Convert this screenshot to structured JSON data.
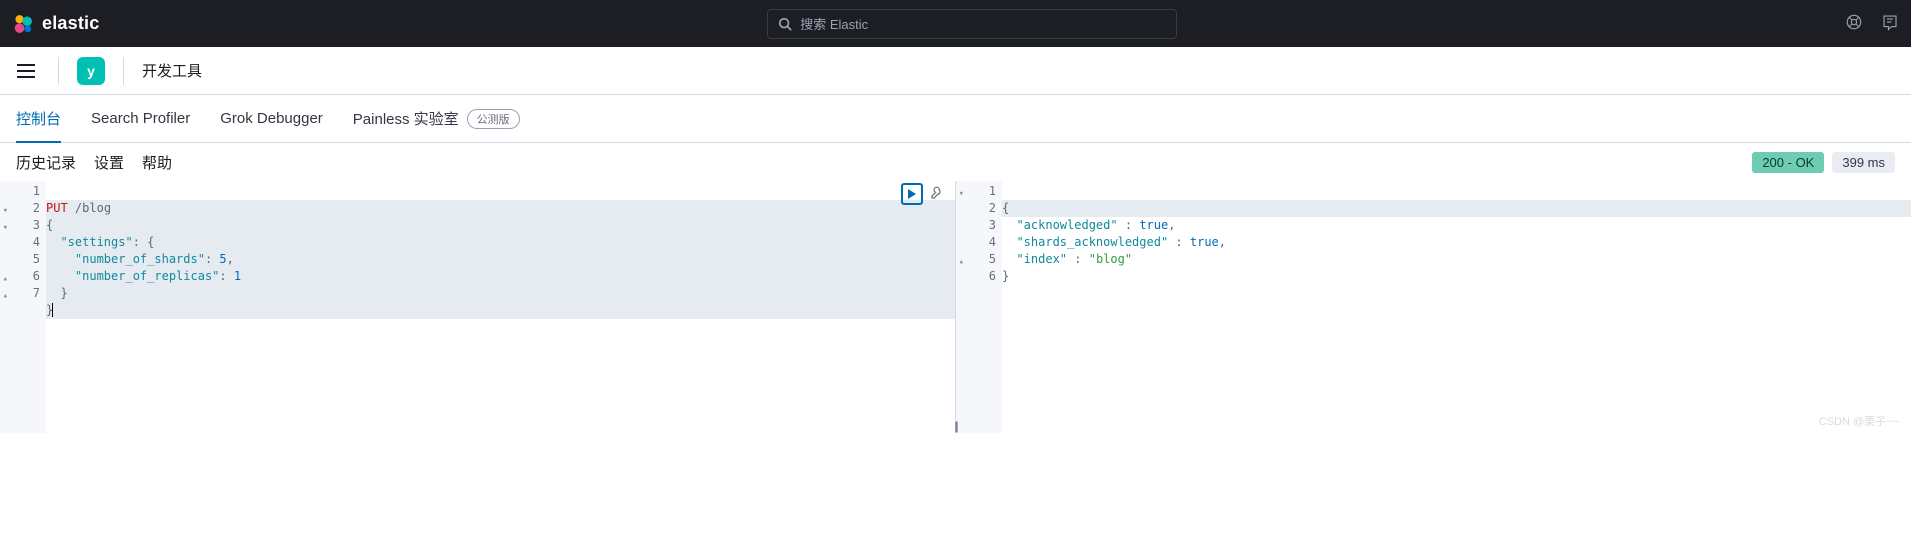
{
  "header": {
    "brand": "elastic",
    "search_placeholder": "搜索 Elastic"
  },
  "subheader": {
    "space_initial": "y",
    "crumb": "开发工具"
  },
  "tabs": [
    {
      "label": "控制台",
      "active": true
    },
    {
      "label": "Search Profiler"
    },
    {
      "label": "Grok Debugger"
    },
    {
      "label": "Painless 实验室",
      "beta": "公测版"
    }
  ],
  "toolbar": {
    "history": "历史记录",
    "settings": "设置",
    "help": "帮助",
    "status": "200 - OK",
    "time": "399 ms"
  },
  "request": {
    "method": "PUT",
    "path": "/blog",
    "lines": [
      {
        "n": "1"
      },
      {
        "n": "2",
        "fold": "▾"
      },
      {
        "n": "3",
        "fold": "▾"
      },
      {
        "n": "4"
      },
      {
        "n": "5"
      },
      {
        "n": "6",
        "fold": "▴"
      },
      {
        "n": "7",
        "fold": "▴"
      }
    ],
    "body": {
      "settings_key": "\"settings\"",
      "shards_key": "\"number_of_shards\"",
      "shards_val": "5",
      "replicas_key": "\"number_of_replicas\"",
      "replicas_val": "1"
    }
  },
  "response": {
    "lines": [
      {
        "n": "1",
        "fold": "▾"
      },
      {
        "n": "2"
      },
      {
        "n": "3"
      },
      {
        "n": "4"
      },
      {
        "n": "5",
        "fold": "▴"
      },
      {
        "n": "6"
      }
    ],
    "ack_key": "\"acknowledged\"",
    "ack_val": "true",
    "shack_key": "\"shards_acknowledged\"",
    "shack_val": "true",
    "index_key": "\"index\"",
    "index_val": "\"blog\""
  },
  "watermark": "CSDN @栗子~~"
}
